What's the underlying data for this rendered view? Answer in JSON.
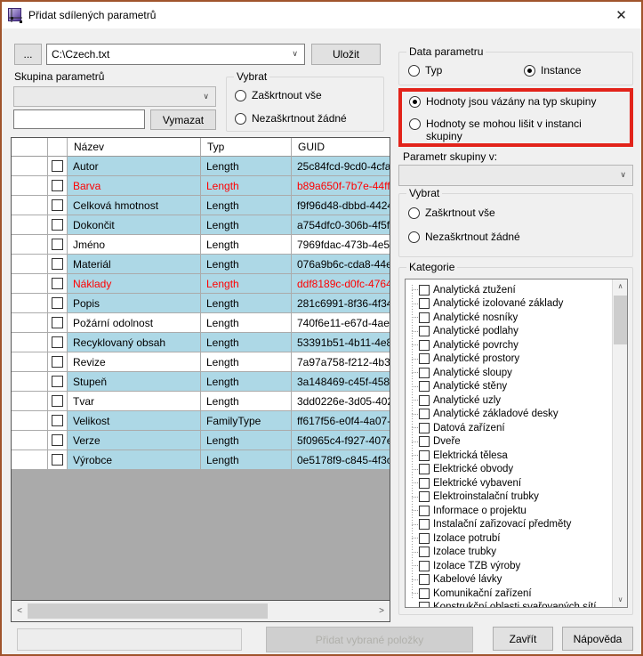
{
  "window": {
    "title": "Přidat sdílených parametrů",
    "close_glyph": "✕"
  },
  "toolbar": {
    "browse_label": "...",
    "file_path": "C:\\Czech.txt",
    "save_label": "Uložit"
  },
  "left_panel": {
    "group_label": "Skupina parametrů",
    "clear_label": "Vymazat",
    "select_group": {
      "title": "Vybrat",
      "options": [
        {
          "label": "Zaškrtnout vše",
          "checked": false
        },
        {
          "label": "Nezaškrtnout žádné",
          "checked": false
        }
      ]
    }
  },
  "table": {
    "headers": {
      "name": "Název",
      "type": "Typ",
      "guid": "GUID"
    },
    "rows": [
      {
        "name": "Autor",
        "type": "Length",
        "guid": "25c84fcd-9cd0-4cfa-",
        "highlighted": true,
        "alert": false
      },
      {
        "name": "Barva",
        "type": "Length",
        "guid": "b89a650f-7b7e-44ff-",
        "highlighted": true,
        "alert": true
      },
      {
        "name": "Celková hmotnost",
        "type": "Length",
        "guid": "f9f96d48-dbbd-4424-",
        "highlighted": true,
        "alert": false
      },
      {
        "name": "Dokončit",
        "type": "Length",
        "guid": "a754dfc0-306b-4f5f-b",
        "highlighted": true,
        "alert": false
      },
      {
        "name": "Jméno",
        "type": "Length",
        "guid": "7969fdac-473b-4e59",
        "highlighted": false,
        "alert": false
      },
      {
        "name": "Materiál",
        "type": "Length",
        "guid": "076a9b6c-cda8-44ea",
        "highlighted": true,
        "alert": false
      },
      {
        "name": "Náklady",
        "type": "Length",
        "guid": "ddf8189c-d0fc-4764-",
        "highlighted": true,
        "alert": true
      },
      {
        "name": "Popis",
        "type": "Length",
        "guid": "281c6991-8f36-4f34-",
        "highlighted": true,
        "alert": false
      },
      {
        "name": "Požární odolnost",
        "type": "Length",
        "guid": "740f6e11-e67d-4ae7",
        "highlighted": false,
        "alert": false
      },
      {
        "name": "Recyklovaný obsah",
        "type": "Length",
        "guid": "53391b51-4b11-4e8a",
        "highlighted": true,
        "alert": false
      },
      {
        "name": "Revize",
        "type": "Length",
        "guid": "7a97a758-f212-4b3d",
        "highlighted": false,
        "alert": false
      },
      {
        "name": "Stupeň",
        "type": "Length",
        "guid": "3a148469-c45f-458a",
        "highlighted": true,
        "alert": false
      },
      {
        "name": "Tvar",
        "type": "Length",
        "guid": "3dd0226e-3d05-402a",
        "highlighted": false,
        "alert": false
      },
      {
        "name": "Velikost",
        "type": "FamilyType",
        "guid": "ff617f56-e0f4-4a07-a",
        "highlighted": true,
        "alert": false
      },
      {
        "name": "Verze",
        "type": "Length",
        "guid": "5f0965c4-f927-407e-",
        "highlighted": true,
        "alert": false
      },
      {
        "name": "Výrobce",
        "type": "Length",
        "guid": "0e5178f9-c845-4f3c-",
        "highlighted": true,
        "alert": false
      }
    ]
  },
  "right_panel": {
    "data_group": {
      "title": "Data parametru",
      "options": [
        {
          "label": "Typ",
          "checked": false
        },
        {
          "label": "Instance",
          "checked": true
        }
      ]
    },
    "binding_options": [
      {
        "label": "Hodnoty jsou vázány na typ skupiny",
        "checked": true
      },
      {
        "label": "Hodnoty se mohou lišit v instanci skupiny",
        "checked": false
      }
    ],
    "group_in_label": "Parametr skupiny v:",
    "select_group": {
      "title": "Vybrat",
      "options": [
        {
          "label": "Zaškrtnout vše",
          "checked": false
        },
        {
          "label": "Nezaškrtnout žádné",
          "checked": false
        }
      ]
    },
    "categories": {
      "title": "Kategorie",
      "items": [
        "Analytická ztužení",
        "Analytické izolované základy",
        "Analytické nosníky",
        "Analytické podlahy",
        "Analytické povrchy",
        "Analytické prostory",
        "Analytické sloupy",
        "Analytické stěny",
        "Analytické uzly",
        "Analytické základové desky",
        "Datová zařízení",
        "Dveře",
        "Elektrická tělesa",
        "Elektrické obvody",
        "Elektrické vybavení",
        "Elektroinstalační trubky",
        "Informace o projektu",
        "Instalační zařizovací předměty",
        "Izolace potrubí",
        "Izolace trubky",
        "Izolace TZB výroby",
        "Kabelové lávky",
        "Komunikační zařízení",
        "Konstrukční oblasti svařovaných sítí"
      ]
    }
  },
  "footer": {
    "add_label": "Přidat vybrané položky",
    "close_label": "Zavřít",
    "help_label": "Nápověda"
  },
  "glyphs": {
    "chevron_down": "∨",
    "scroll_up": "∧",
    "scroll_down": "∨",
    "scroll_left": "<",
    "scroll_right": ">"
  },
  "colors": {
    "window_border": "#a0542c",
    "highlight_row": "#add8e6",
    "alert_text": "#ff0000",
    "annotation_red": "#e2231a"
  }
}
